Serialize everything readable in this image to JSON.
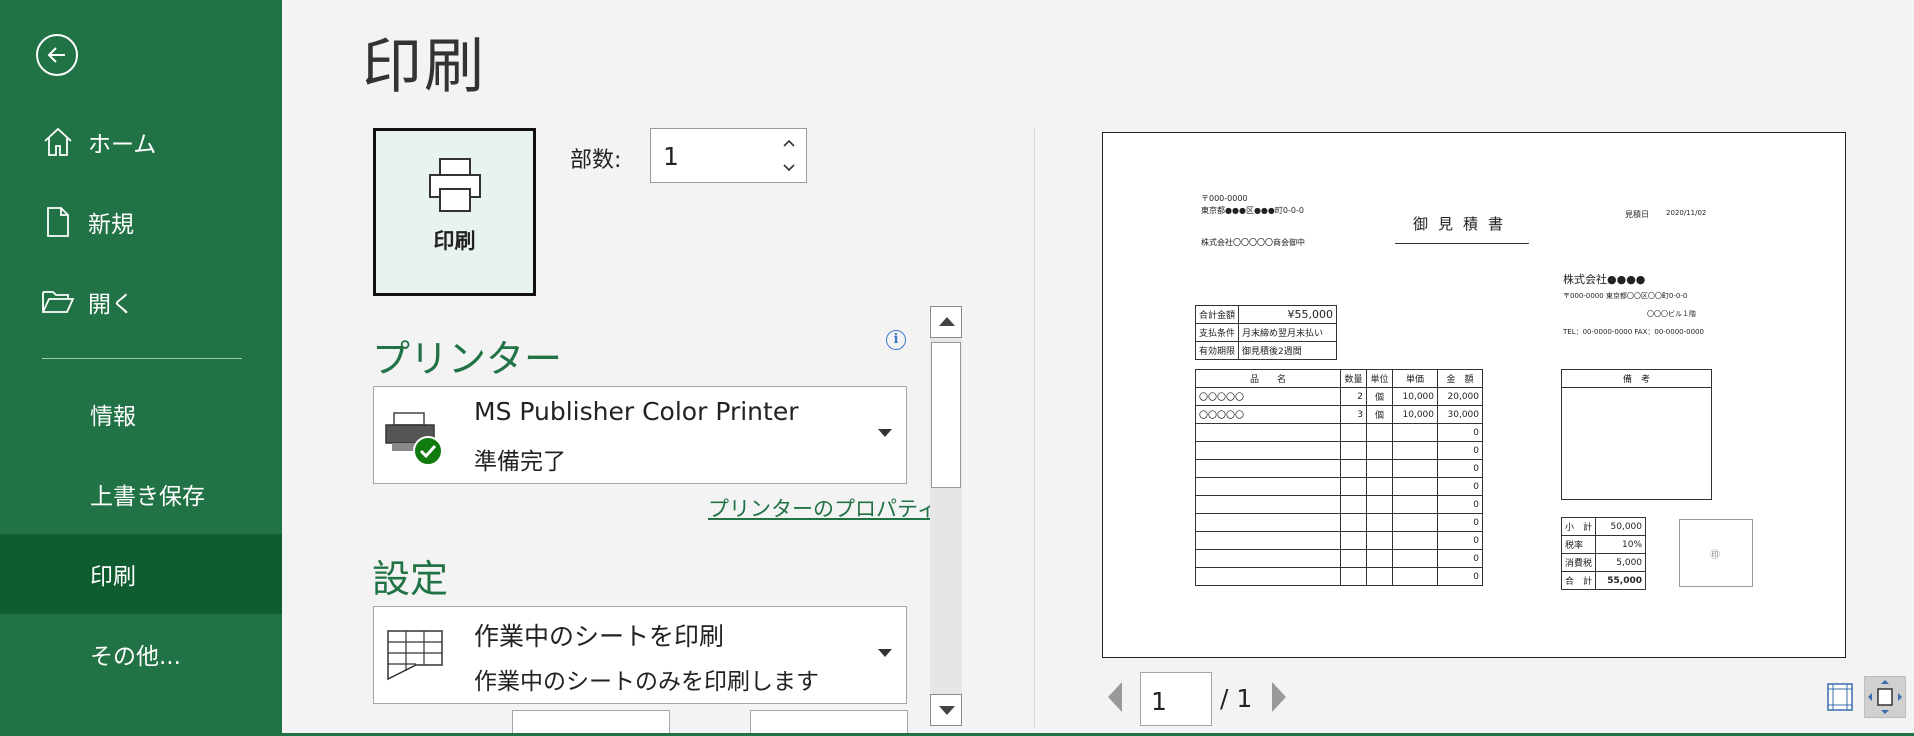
{
  "sidebar": {
    "items": [
      {
        "label": "ホーム",
        "icon": "home-icon"
      },
      {
        "label": "新規",
        "icon": "new-document-icon"
      },
      {
        "label": "開く",
        "icon": "open-folder-icon"
      },
      {
        "label": "情報"
      },
      {
        "label": "上書き保存"
      },
      {
        "label": "印刷",
        "active": true
      },
      {
        "label": "その他..."
      }
    ]
  },
  "main": {
    "title": "印刷",
    "print_button_label": "印刷",
    "copies_label": "部数:",
    "copies_value": "1",
    "printer_heading": "プリンター",
    "printer_name": "MS Publisher Color Printer",
    "printer_status": "準備完了",
    "printer_properties_link": "プリンターのプロパティ",
    "settings_heading": "設定",
    "setting_scope_title": "作業中のシートを印刷",
    "setting_scope_desc": "作業中のシートのみを印刷します",
    "page_current": "1",
    "page_total": "/ 1",
    "info_glyph": "i"
  },
  "preview": {
    "postal": "〒000-0000",
    "address": "東京都●●●区●●●町0-0-0",
    "recipient": "株式会社〇〇〇〇〇商会御中",
    "doc_title": "御見積書",
    "date_label": "見積日",
    "date_value": "2020/11/02",
    "company": "株式会社●●●●",
    "company_addr": "〒000-0000  東京都〇〇区〇〇町0-0-0",
    "company_bldg": "〇〇〇ビル１階",
    "company_tel": "TEL：00-0000-0000  FAX：00-0000-0000",
    "summary": [
      {
        "k": "合計金額",
        "v": "¥55,000"
      },
      {
        "k": "支払条件",
        "v": "月末締め翌月末払い"
      },
      {
        "k": "有効期限",
        "v": "御見積後2週間"
      }
    ],
    "items_header": [
      "品　　名",
      "数量",
      "単位",
      "単価",
      "金　額"
    ],
    "items": [
      [
        "〇〇〇〇〇",
        "2",
        "個",
        "10,000",
        "20,000"
      ],
      [
        "〇〇〇〇〇",
        "3",
        "個",
        "10,000",
        "30,000"
      ],
      [
        "",
        "",
        "",
        "",
        "0"
      ],
      [
        "",
        "",
        "",
        "",
        "0"
      ],
      [
        "",
        "",
        "",
        "",
        "0"
      ],
      [
        "",
        "",
        "",
        "",
        "0"
      ],
      [
        "",
        "",
        "",
        "",
        "0"
      ],
      [
        "",
        "",
        "",
        "",
        "0"
      ],
      [
        "",
        "",
        "",
        "",
        "0"
      ],
      [
        "",
        "",
        "",
        "",
        "0"
      ],
      [
        "",
        "",
        "",
        "",
        "0"
      ]
    ],
    "remarks_header": "備　考",
    "totals": [
      {
        "k": "小　計",
        "v": "50,000"
      },
      {
        "k": "税率",
        "v": "10%"
      },
      {
        "k": "消費税",
        "v": "5,000"
      },
      {
        "k": "合　計",
        "v": "55,000"
      }
    ],
    "stamp": "㊞"
  },
  "colors": {
    "accent": "#217346",
    "accent_dark": "#0e5c30"
  }
}
